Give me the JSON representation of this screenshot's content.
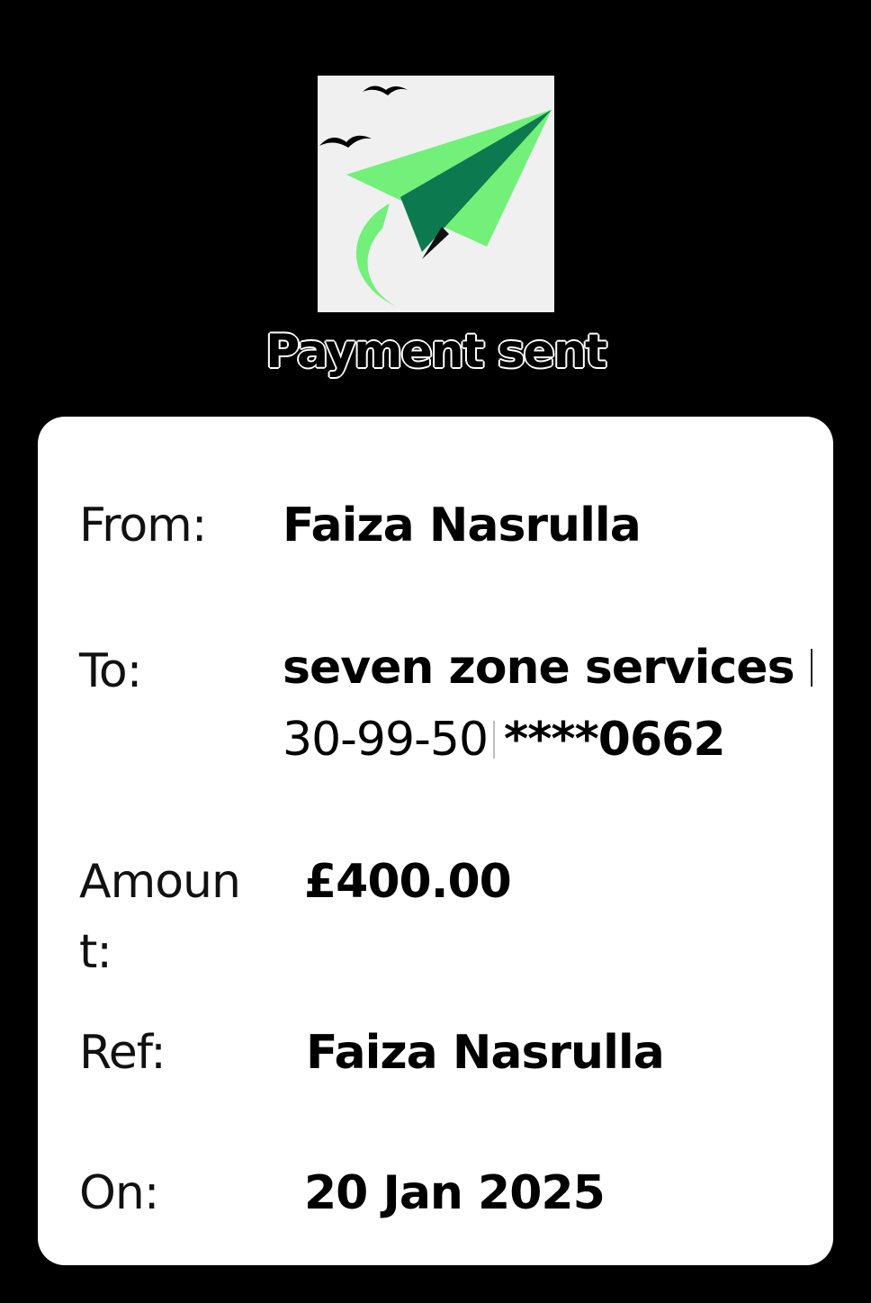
{
  "header": {
    "title": "Payment sent",
    "logo_icon": "paper-plane-icon",
    "logo_colors": {
      "background": "#f0f0f0",
      "plane_light": "#72f07a",
      "plane_dark": "#0c7a4e",
      "birds": "#000000"
    }
  },
  "details": {
    "from_label": "From:",
    "from_value": "Faiza Nasrulla",
    "to_label": "To:",
    "to_name": "seven zone services",
    "to_sort_code": "30-99-50",
    "to_account_masked": "****0662",
    "amount_label_line1": "Amoun",
    "amount_label_line2": "t:",
    "amount_value": "£400.00",
    "ref_label": "Ref:",
    "ref_value": "Faiza Nasrulla",
    "on_label": "On:",
    "on_value": "20 Jan 2025"
  }
}
